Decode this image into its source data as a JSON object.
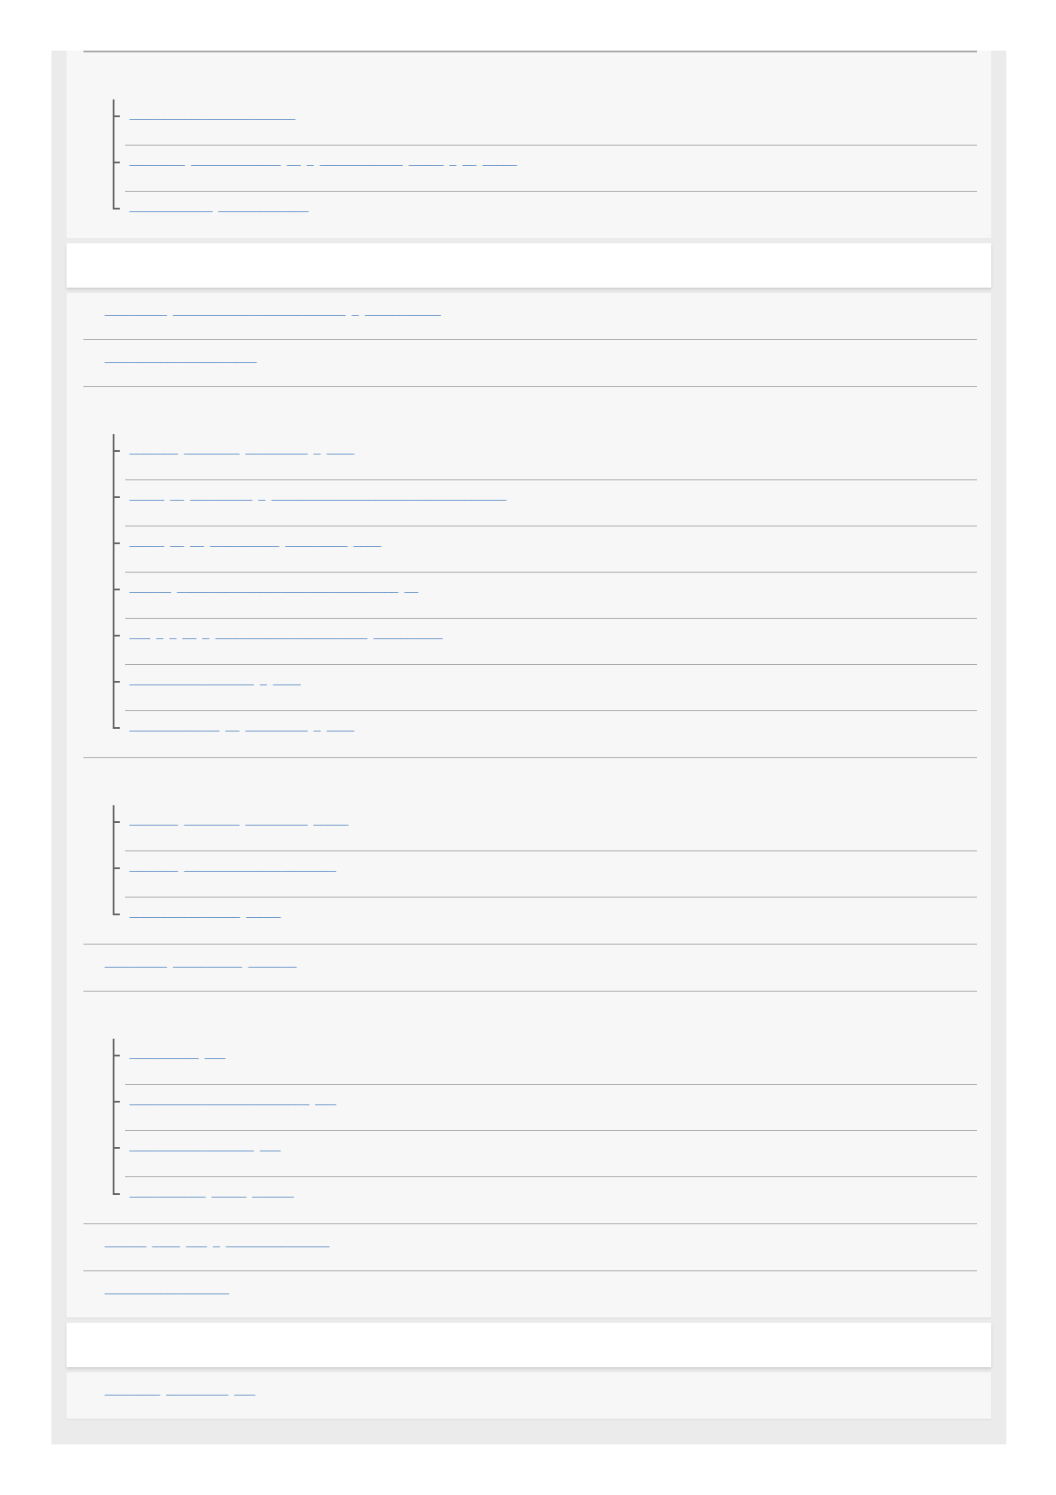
{
  "sections": [
    {
      "kind": "list",
      "cut_top": true,
      "items": [
        {
          "children": [
            {
              "text": "________________________"
            },
            {
              "text": "________ _____________ __ _ ____________ _____ _ __ _____"
            },
            {
              "text": "____________ _____________"
            }
          ]
        }
      ]
    },
    {
      "kind": "band"
    },
    {
      "kind": "list",
      "cut_top": false,
      "items": [
        {
          "text": "_________ _________________________ _ ___________"
        },
        {
          "text": "______________________"
        },
        {
          "children": [
            {
              "text": "_______ ________ _________ _ ____"
            },
            {
              "text": "_____ __ _________ _ __________________________________"
            },
            {
              "text": "_____ __ __ __________ _________ ____"
            },
            {
              "text": "______ ________________________________ __"
            },
            {
              "text": "___ _ _ __ _ ______________________ __________"
            },
            {
              "text": "__________________ _ ____"
            },
            {
              "text": "_____________ __ _________ _ ____"
            }
          ]
        },
        {
          "children": [
            {
              "text": "_______ ________ _________ _____"
            },
            {
              "text": "_______ ______________________"
            },
            {
              "text": "________________ _____"
            }
          ]
        },
        {
          "text": "_________ __________ _______"
        },
        {
          "children": [
            {
              "text": "__________ ___"
            },
            {
              "text": "__________________________ ___"
            },
            {
              "text": "__________________ ___"
            },
            {
              "text": "___________ _____ ______"
            }
          ]
        },
        {
          "text": "______ ____ ___ _ _______________"
        },
        {
          "text": "__________________"
        }
      ]
    },
    {
      "kind": "band"
    },
    {
      "kind": "list",
      "cut_top": false,
      "items": [
        {
          "text": "________ _________ ___"
        }
      ]
    }
  ]
}
